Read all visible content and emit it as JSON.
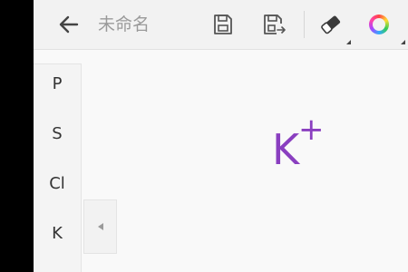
{
  "toolbar": {
    "title": "未命名",
    "icons": {
      "back": "arrow-left-icon",
      "save": "floppy-disk-icon",
      "export": "floppy-export-icon",
      "eraser": "eraser-icon",
      "color": "color-wheel-icon"
    }
  },
  "palette": {
    "elements": [
      "P",
      "S",
      "Cl",
      "K"
    ]
  },
  "canvas": {
    "symbol": "K",
    "charge": "+"
  },
  "colors": {
    "accent": "#8a3fc0",
    "toolbar_bg": "#f2f2f2",
    "canvas_bg": "#f9f9f9"
  }
}
